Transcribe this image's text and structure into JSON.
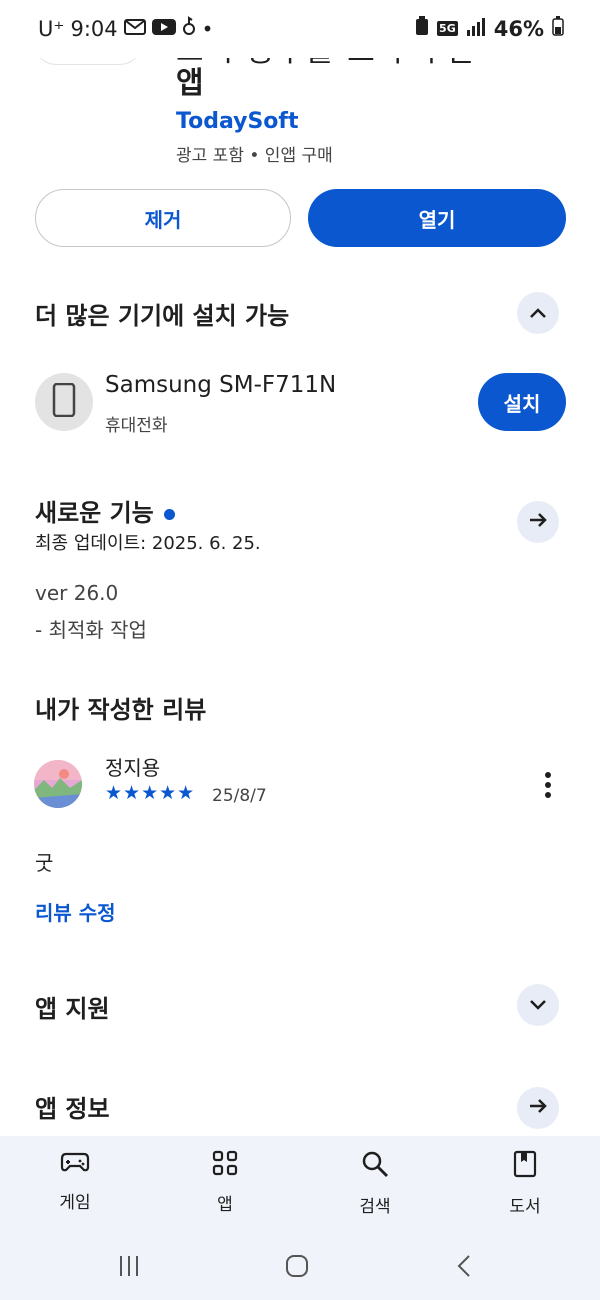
{
  "status_bar": {
    "carrier": "U⁺",
    "time": "9:04",
    "network": "5G",
    "battery": "46%"
  },
  "app": {
    "title_cut": "고시 공부를 도와 주는",
    "title_line2": "앱",
    "developer": "TodaySoft",
    "meta": "광고 포함  •  인앱 구매"
  },
  "actions": {
    "remove_label": "제거",
    "open_label": "열기"
  },
  "more_devices": {
    "title": "더 많은 기기에 설치 가능",
    "device_name": "Samsung SM-F711N",
    "device_type": "휴대전화",
    "install_label": "설치"
  },
  "whats_new": {
    "title": "새로운 기능",
    "updated": "최종 업데이트: 2025. 6. 25.",
    "version": "ver 26.0",
    "note": "- 최적화 작업"
  },
  "my_review": {
    "title": "내가 작성한 리뷰",
    "reviewer": "정지용",
    "stars": "★★★★★",
    "rating": 5,
    "date": "25/8/7",
    "text": "굿",
    "edit_label": "리뷰 수정"
  },
  "sections": {
    "app_support": "앱 지원",
    "app_info": "앱 정보"
  },
  "bottom_nav": {
    "items": [
      {
        "label": "게임",
        "icon": "gamepad-icon"
      },
      {
        "label": "앱",
        "icon": "apps-grid-icon"
      },
      {
        "label": "검색",
        "icon": "search-icon"
      },
      {
        "label": "도서",
        "icon": "book-icon"
      }
    ]
  },
  "colors": {
    "accent": "#0b57d0",
    "nav_bg": "#f0f3f9",
    "circle_btn_bg": "#e8ecf6"
  }
}
